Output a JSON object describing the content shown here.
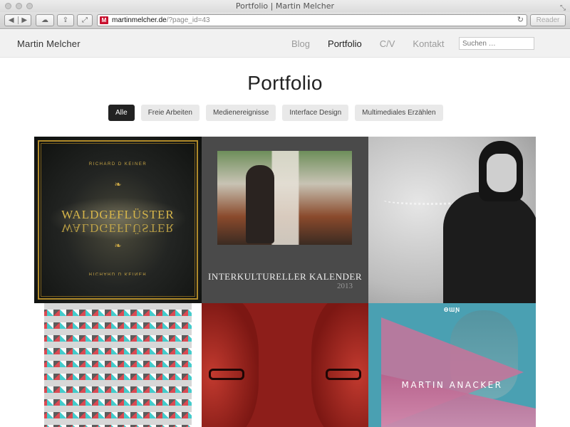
{
  "browser": {
    "window_title": "Portfolio | Martin Melcher",
    "url_domain": "martinmelcher.de",
    "url_path": "/?page_id=43",
    "reader_label": "Reader",
    "favicon_letter": "M",
    "back_glyph": "◀",
    "forward_glyph": "▶",
    "cloud_glyph": "☁",
    "share_glyph": "⇪",
    "expand_glyph": "⤢",
    "reload_glyph": "↻",
    "resize_glyph": "⤡"
  },
  "site": {
    "name": "Martin Melcher",
    "nav": [
      {
        "label": "Blog",
        "active": false
      },
      {
        "label": "Portfolio",
        "active": true
      },
      {
        "label": "C/V",
        "active": false
      },
      {
        "label": "Kontakt",
        "active": false
      }
    ],
    "search_placeholder": "Suchen …"
  },
  "page": {
    "title": "Portfolio",
    "filters": [
      {
        "label": "Alle",
        "active": true
      },
      {
        "label": "Freie Arbeiten",
        "active": false
      },
      {
        "label": "Medienereignisse",
        "active": false
      },
      {
        "label": "Interface Design",
        "active": false
      },
      {
        "label": "Multimediales Erzählen",
        "active": false
      }
    ]
  },
  "portfolio": {
    "waldgefluester": {
      "artist": "RICHARD D KEINER",
      "artist_reversed": "RICHARD D KEINER",
      "title": "WALDGEFLÜSTER",
      "title_reversed": "WALDGEFLÜSTER",
      "ornament": "❧"
    },
    "kalender": {
      "title": "INTERKULTURELLER KALENDER",
      "year": "2013"
    },
    "anacker": {
      "logo": "ƟƜƝ",
      "name": "MARTIN ANACKER"
    }
  },
  "colors": {
    "accent_dark": "#222222",
    "nav_inactive": "#9b9b9b",
    "favicon_red": "#c8102e"
  }
}
